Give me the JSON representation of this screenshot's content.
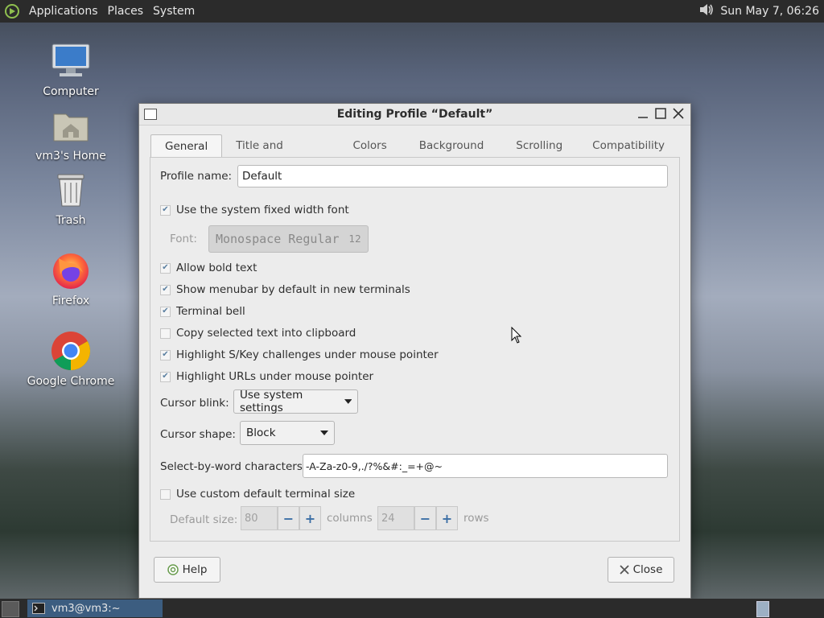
{
  "top_panel": {
    "menus": [
      "Applications",
      "Places",
      "System"
    ],
    "clock": "Sun May  7, 06:26"
  },
  "desktop_icons": [
    {
      "label": "Computer",
      "icon": "computer-icon"
    },
    {
      "label": "vm3's Home",
      "icon": "home-folder-icon"
    },
    {
      "label": "Trash",
      "icon": "trash-icon"
    },
    {
      "label": "Firefox",
      "icon": "firefox-icon"
    },
    {
      "label": "Google Chrome",
      "icon": "chrome-icon"
    }
  ],
  "dialog": {
    "title": "Editing Profile “Default”",
    "tabs": [
      "General",
      "Title and Command",
      "Colors",
      "Background",
      "Scrolling",
      "Compatibility"
    ],
    "active_tab": "General",
    "profile_name_label": "Profile name:",
    "profile_name_value": "Default",
    "use_system_font_label": "Use the system fixed width font",
    "use_system_font_checked": true,
    "font_label": "Font:",
    "font_name": "Monospace Regular",
    "font_size": "12",
    "checkboxes": [
      {
        "label": "Allow bold text",
        "checked": true
      },
      {
        "label": "Show menubar by default in new terminals",
        "checked": true
      },
      {
        "label": "Terminal bell",
        "checked": true
      },
      {
        "label": "Copy selected text into clipboard",
        "checked": false
      },
      {
        "label": "Highlight S/Key challenges under mouse pointer",
        "checked": true
      },
      {
        "label": "Highlight URLs under mouse pointer",
        "checked": true
      }
    ],
    "cursor_blink_label": "Cursor blink:",
    "cursor_blink_value": "Use system settings",
    "cursor_shape_label": "Cursor shape:",
    "cursor_shape_value": "Block",
    "select_by_word_label": "Select-by-word characters:",
    "select_by_word_value": "-A-Za-z0-9,./?%&#:_=+@~",
    "custom_size_label": "Use custom default terminal size",
    "custom_size_checked": false,
    "default_size_label": "Default size:",
    "columns_value": "80",
    "columns_label": "columns",
    "rows_value": "24",
    "rows_label": "rows",
    "help_label": "Help",
    "close_label": "Close"
  },
  "taskbar": {
    "window_label": "vm3@vm3:~"
  }
}
